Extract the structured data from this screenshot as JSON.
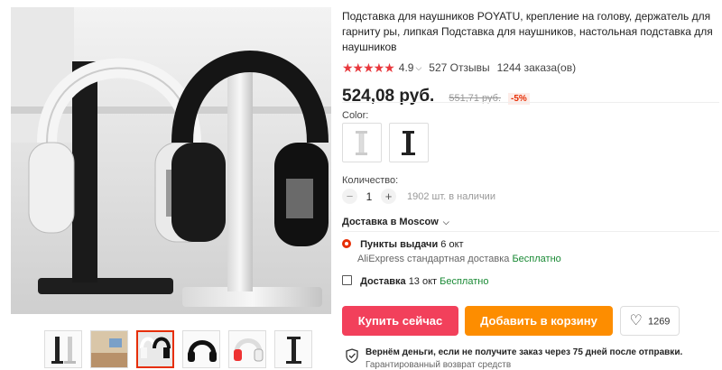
{
  "product": {
    "title": "Подставка для наушников POYATU, крепление на голову, держатель для гарниту ры, липкая Подставка для наушников, настольная подставка для наушников",
    "stars": "★★★★★",
    "rating": "4.9",
    "reviews": "527 Отзывы",
    "orders": "1244 заказа(ов)",
    "price": "524,08 руб.",
    "old_price": "551,71 руб.",
    "discount": "-5%"
  },
  "options": {
    "color_label": "Color:",
    "swatches": [
      "white-stand",
      "black-stand"
    ],
    "qty_label": "Количество:",
    "qty_minus": "−",
    "qty_value": "1",
    "qty_plus": "+",
    "stock": "1902 шт. в наличии"
  },
  "delivery": {
    "heading": "Доставка в Moscow",
    "pickup_title": "Пункты выдачи",
    "pickup_date": "6 окт",
    "pickup_service": "AliExpress стандартная доставка",
    "pickup_price": "Бесплатно",
    "courier_title": "Доставка",
    "courier_date": "13 окт",
    "courier_price": "Бесплатно"
  },
  "actions": {
    "buy_label": "Купить сейчас",
    "cart_label": "Добавить в корзину",
    "wish_count": "1269"
  },
  "guarantee": {
    "line1": "Вернём деньги, если не получите заказ через 75 дней после отправки.",
    "line2": "Гарантированный возврат средств"
  },
  "colors": {
    "buy": "#f2405b",
    "cart": "#fd8d00",
    "star": "#e8383d",
    "free": "#1a8a35"
  },
  "gallery": {
    "thumbnails": [
      "stand-pair",
      "desk-scene",
      "stands-with-headphones",
      "black-headphones",
      "white-headphones",
      "black-stand"
    ],
    "active_index": 2
  }
}
